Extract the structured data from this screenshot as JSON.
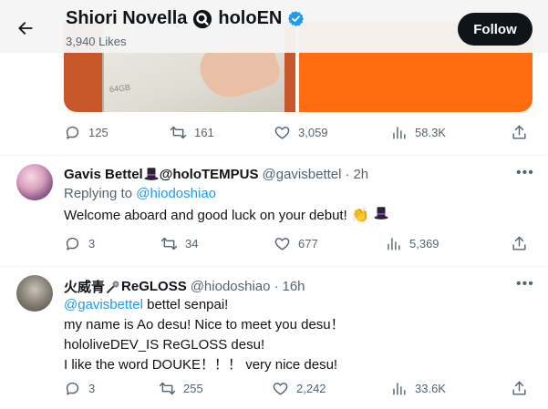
{
  "header": {
    "name": "Shiori Novella",
    "affiliation": "holoEN",
    "likes": "3,940 Likes",
    "follow_label": "Follow"
  },
  "media": {
    "box_label": "64GB"
  },
  "main_tweet": {
    "replies": "125",
    "reposts": "161",
    "likes": "3,059",
    "views": "58.3K"
  },
  "replies": [
    {
      "name_prefix": "Gavis Bettel",
      "name_suffix": "@holoTEMPUS",
      "handle": "@gavisbettel",
      "time": "2h",
      "replying_to_label": "Replying to",
      "replying_to_handle": "@hiodoshiao",
      "body": "Welcome aboard and good luck on your debut!",
      "stats": {
        "replies": "3",
        "reposts": "34",
        "likes": "677",
        "views": "5,369"
      }
    },
    {
      "name_prefix": "火威青",
      "name_suffix": "ReGLOSS",
      "handle": "@hiodoshiao",
      "time": "16h",
      "mention": "@gavisbettel",
      "line1_rest": " bettel senpai!",
      "line2": "my name is Ao desu! Nice to meet you desu！",
      "line3": "hololiveDEV_IS ReGLOSS desu!",
      "line4": "I like the word DOUKE！！！ very nice desu!",
      "stats": {
        "replies": "3",
        "reposts": "255",
        "likes": "2,242",
        "views": "33.6K"
      }
    }
  ],
  "colors": {
    "text": "#0f1419",
    "muted": "#536471",
    "link": "#1d9bf0",
    "verified": "#1d9bf0"
  },
  "icons": [
    "back-arrow-icon",
    "holo-q-icon",
    "verified-badge-icon",
    "reply-icon",
    "repost-icon",
    "like-icon",
    "views-icon",
    "share-icon",
    "more-icon",
    "top-hat-icon",
    "microphone-icon",
    "clapping-hands-icon"
  ]
}
